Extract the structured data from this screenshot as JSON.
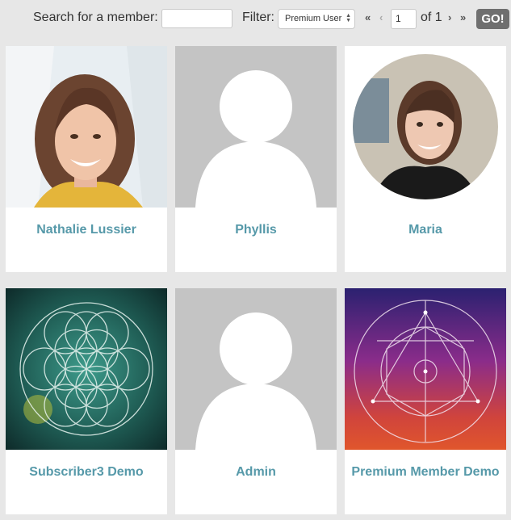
{
  "toolbar": {
    "search_label": "Search for a member:",
    "search_value": "",
    "filter_label": "Filter:",
    "filter_selected": "Premium User",
    "first_page": "«",
    "prev_page": "‹",
    "page_value": "1",
    "page_of": "of 1",
    "next_page": "›",
    "last_page": "»",
    "go_label": "GO!"
  },
  "members": [
    {
      "name": "Nathalie Lussier",
      "avatar": "photo"
    },
    {
      "name": "Phyllis",
      "avatar": "default-avatar"
    },
    {
      "name": "Maria",
      "avatar": "circular-photo"
    },
    {
      "name": "Subscriber3 Demo",
      "avatar": "flower-of-life"
    },
    {
      "name": "Admin",
      "avatar": "default-avatar"
    },
    {
      "name": "Premium Member Demo",
      "avatar": "sacred-geometry"
    }
  ],
  "colors": {
    "background": "#e7e7e7",
    "name_link": "#5699a9",
    "go_button": "#6f6f6f",
    "placeholder": "#c4c4c4"
  }
}
